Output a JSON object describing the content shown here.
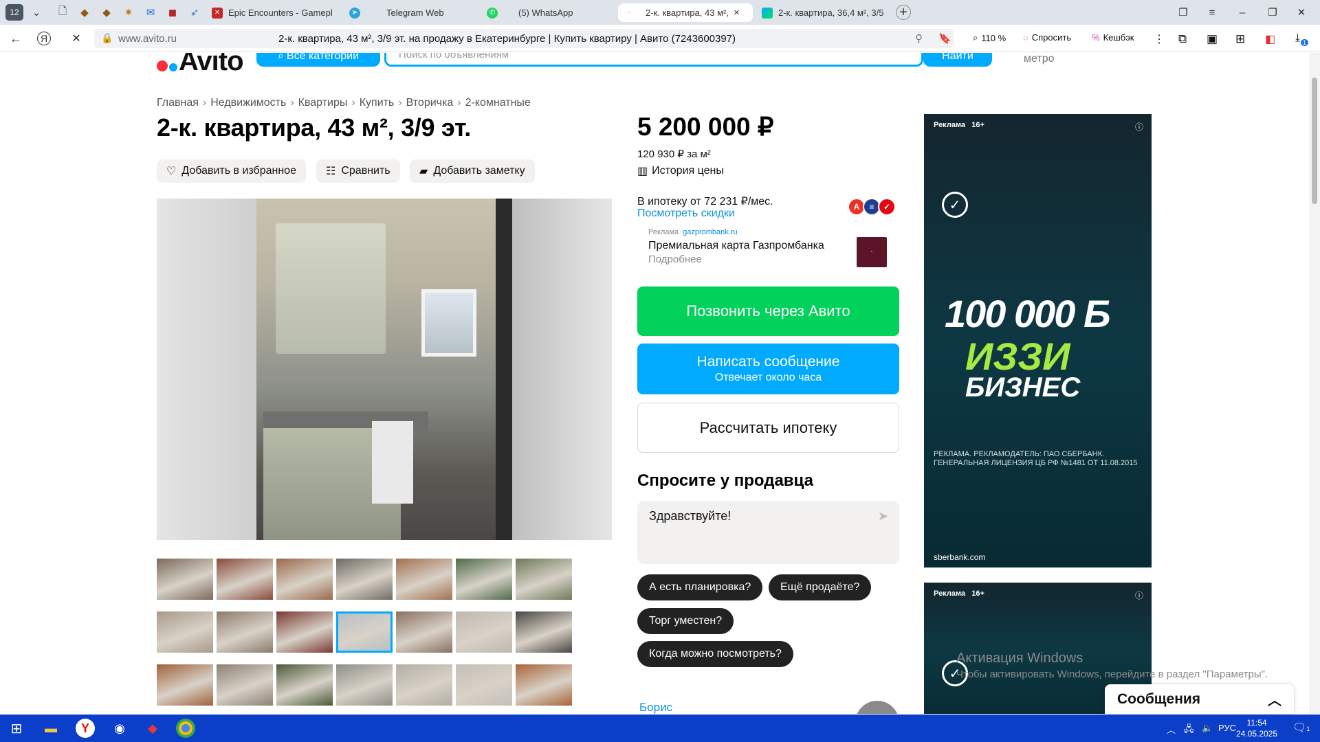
{
  "browser": {
    "tab_counter": "12",
    "tabs": [
      {
        "label": "Epic Encounters - Gamepl",
        "icon": "epic-icon"
      },
      {
        "label": "Telegram Web",
        "icon": "telegram-icon"
      },
      {
        "label": "(5) WhatsApp",
        "icon": "whatsapp-icon"
      },
      {
        "label": "2-к. квартира, 43 м², 3/",
        "icon": "loading-icon"
      },
      {
        "label": "2-к. квартира, 36,4 м², 3/5",
        "icon": "avito-icon"
      }
    ],
    "close_symbol": "×",
    "url_domain": "www.avito.ru",
    "page_title": "2-к. квартира, 43 м², 3/9 эт. на продажу в Екатеринбурге | Купить квартиру | Авито (7243600397)",
    "zoom": "110 %",
    "ask_label": "Спросить",
    "cashback_label": "Кешбэк",
    "downloads_badge": "1"
  },
  "header": {
    "logo": "Avito",
    "categories_button": "Все категории",
    "search_placeholder": "Поиск по объявлениям",
    "find_button": "Найти",
    "metro": "метро"
  },
  "breadcrumbs": [
    "Главная",
    "Недвижимость",
    "Квартиры",
    "Купить",
    "Вторичка",
    "2-комнатные"
  ],
  "listing": {
    "title": "2-к. квартира, 43 м², 3/9 эт.",
    "actions": {
      "favorite": "Добавить в избранное",
      "compare": "Сравнить",
      "note": "Добавить заметку"
    },
    "thumbnail_rows": 3,
    "thumbnails_per_row": 7,
    "selected_thumbnail": 10
  },
  "sidebar": {
    "price": "5 200 000 ₽",
    "price_per_m2": "120 930 ₽ за м²",
    "price_history": "История цены",
    "mortgage": "В ипотеку от 72 231 ₽/мес.",
    "discounts": "Посмотреть скидки",
    "ad_label": "Реклама",
    "ad_domain": "gazprombank.ru",
    "ad_title": "Премиальная карта Газпромбанка",
    "ad_more": "Подробнее",
    "call_button": "Позвонить через Авито",
    "message_button": "Написать сообщение",
    "message_sub": "Отвечает около часа",
    "calc_button": "Рассчитать ипотеку",
    "ask_heading": "Спросите у продавца",
    "chat_text": "Здравствуйте!",
    "quick_questions": [
      "А есть планировка?",
      "Ещё продаёте?",
      "Торг уместен?",
      "Когда можно посмотреть?"
    ],
    "seller_name": "Борис"
  },
  "ads": {
    "label": "Реклама",
    "age": "16+",
    "big_number": "100 000 Б",
    "line1": "ИЗЗИ",
    "line2": "БИЗНЕС",
    "legal": "РЕКЛАМА. РЕКЛАМОДАТЕЛЬ: ПАО СБЕРБАНК. ГЕНЕРАЛЬНАЯ ЛИЦЕНЗИЯ ЦБ РФ №1481 ОТ 11.08.2015",
    "domain": "sberbank.com"
  },
  "windows": {
    "activation_title": "Активация Windows",
    "activation_text": "Чтобы активировать Windows, перейдите в раздел \"Параметры\".",
    "messages_panel": "Сообщения",
    "lang": "РУС",
    "time": "11:54",
    "date": "24.05.2025",
    "notif_count": "1"
  },
  "colors": {
    "avito_blue": "#00aaff",
    "call_green": "#02d15c",
    "taskbar": "#0c3fc9"
  }
}
